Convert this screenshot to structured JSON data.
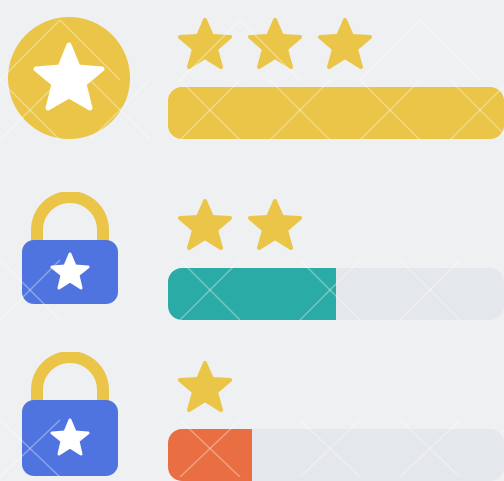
{
  "colors": {
    "background": "#eef0f2",
    "gold": "#eac547",
    "white": "#ffffff",
    "lock_blue": "#4f73df",
    "teal": "#2aaba5",
    "orange": "#e96f43",
    "track": "#e4e7ec"
  },
  "levels": [
    {
      "icon": "star-badge-icon",
      "stars": 3,
      "progress": 1.0,
      "fill_color": "#eac547",
      "track_color": "#eac547"
    },
    {
      "icon": "star-lock-icon",
      "stars": 2,
      "progress": 0.5,
      "fill_color": "#2aaba5",
      "track_color": "#e4e7ec"
    },
    {
      "icon": "star-lock-icon",
      "stars": 1,
      "progress": 0.25,
      "fill_color": "#e96f43",
      "track_color": "#e4e7ec"
    }
  ]
}
